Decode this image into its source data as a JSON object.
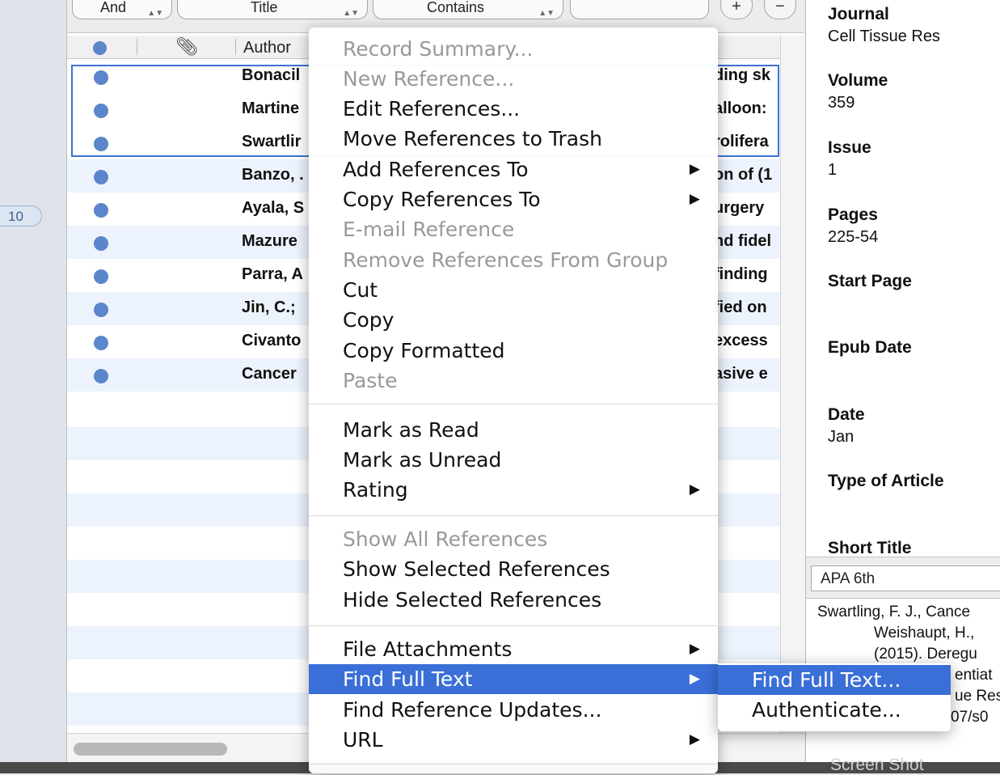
{
  "sidebar": {
    "group_count": "10"
  },
  "search": {
    "bool_value": "And",
    "field_value": "Title",
    "operator_value": "Contains",
    "term_value": "",
    "add_label": "+",
    "remove_label": "−"
  },
  "columns": {
    "author_header": "Author"
  },
  "rows": [
    {
      "author": "Bonacil",
      "title_fragment": "ding sk",
      "selected": true
    },
    {
      "author": "Martine",
      "title_fragment": "alloon:",
      "selected": true
    },
    {
      "author": "Swartlir",
      "title_fragment": "rolifera",
      "selected": true
    },
    {
      "author": "Banzo, .",
      "title_fragment": "on of (1",
      "selected": false
    },
    {
      "author": "Ayala, S",
      "title_fragment": "urgery",
      "selected": false
    },
    {
      "author": "Mazure",
      "title_fragment": "nd fidel",
      "selected": false
    },
    {
      "author": "Parra, A",
      "title_fragment": "finding",
      "selected": false
    },
    {
      "author": "Jin, C.;",
      "title_fragment": "fied on",
      "selected": false
    },
    {
      "author": "Civanto",
      "title_fragment": "excess",
      "selected": false
    },
    {
      "author": "Cancer",
      "title_fragment": "asive e",
      "selected": false
    }
  ],
  "context_menu": {
    "items": [
      {
        "label": "Record Summary...",
        "disabled": true
      },
      {
        "label": "New Reference...",
        "disabled": true
      },
      {
        "label": "Edit References...",
        "disabled": false
      },
      {
        "label": "Move References to Trash",
        "disabled": false
      },
      {
        "label": "Add References To",
        "disabled": false,
        "submenu": true
      },
      {
        "label": "Copy References To",
        "disabled": false,
        "submenu": true
      },
      {
        "label": "E-mail Reference",
        "disabled": true
      },
      {
        "label": "Remove References From Group",
        "disabled": true
      },
      {
        "label": "Cut",
        "disabled": false
      },
      {
        "label": "Copy",
        "disabled": false
      },
      {
        "label": "Copy Formatted",
        "disabled": false
      },
      {
        "label": "Paste",
        "disabled": true
      },
      {
        "label": "Mark as Read",
        "disabled": false
      },
      {
        "label": "Mark as Unread",
        "disabled": false
      },
      {
        "label": "Rating",
        "disabled": false,
        "submenu": true
      },
      {
        "label": "Show All References",
        "disabled": true
      },
      {
        "label": "Show Selected References",
        "disabled": false
      },
      {
        "label": "Hide Selected References",
        "disabled": false
      },
      {
        "label": "File Attachments",
        "disabled": false,
        "submenu": true
      },
      {
        "label": "Find Full Text",
        "disabled": false,
        "submenu": true,
        "highlighted": true
      },
      {
        "label": "Find Reference Updates...",
        "disabled": false
      },
      {
        "label": "URL",
        "disabled": false,
        "submenu": true
      }
    ],
    "submenu_arrow": "▶"
  },
  "find_full_text_submenu": {
    "items": [
      {
        "label": "Find Full Text...",
        "highlighted": true
      },
      {
        "label": "Authenticate...",
        "highlighted": false
      }
    ]
  },
  "reference_panel": {
    "fields": [
      {
        "label": "Journal",
        "value": "Cell Tissue Res"
      },
      {
        "label": "Volume",
        "value": "359"
      },
      {
        "label": "Issue",
        "value": "1"
      },
      {
        "label": "Pages",
        "value": "225-54"
      },
      {
        "label": "Start Page",
        "value": ""
      },
      {
        "label": "Epub Date",
        "value": ""
      },
      {
        "label": "Date",
        "value": "Jan"
      },
      {
        "label": "Type of Article",
        "value": ""
      },
      {
        "label": "Short Title",
        "value": ""
      }
    ],
    "output_style": "APA 6th",
    "preview_lines": [
      "Swartling, F. J., Cance",
      "Weishaupt, H.,",
      "(2015). Deregu",
      "entiat",
      "ue Res",
      "07/s0"
    ]
  },
  "dock": {
    "screenshot_label": "Screen Shot"
  },
  "colors": {
    "selection_blue": "#3a6fd8",
    "read_dot": "#5b86cc",
    "row_stripe": "#edf3fd"
  }
}
